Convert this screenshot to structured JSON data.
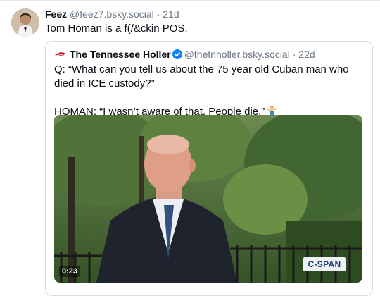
{
  "post": {
    "author": "Feez",
    "handle": "@feez7.bsky.social",
    "separator": "·",
    "age": "21d",
    "text": "Tom Homan is a f(/&ckin POS."
  },
  "quote": {
    "author": "The Tennessee Holler",
    "handle": "@thetnholler.bsky.social",
    "separator": "·",
    "age": "22d",
    "line1": "Q: “What can you tell us about the 75 year old Cuban man who died in ICE custody?”",
    "line2": "HOMAN: “I wasn’t aware of that. People die.”",
    "emoji_icon": "person-shrugging-icon",
    "verified_icon": "verified-badge-icon",
    "video": {
      "duration": "0:23",
      "watermark": "C-SPAN"
    }
  }
}
